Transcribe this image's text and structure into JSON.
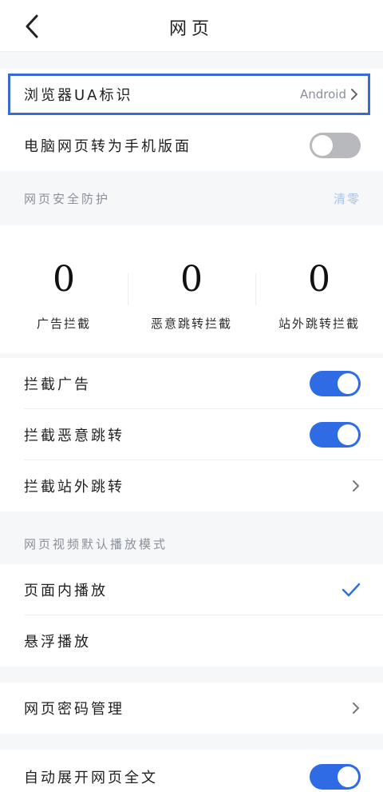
{
  "header": {
    "title": "网页",
    "back_icon": "chevron-left-icon"
  },
  "ua": {
    "label": "浏览器UA标识",
    "value": "Android"
  },
  "pc_to_mobile": {
    "label": "电脑网页转为手机版面",
    "enabled": false
  },
  "security": {
    "title": "网页安全防护",
    "clear_label": "清零",
    "stats": [
      {
        "value": "0",
        "label": "广告拦截"
      },
      {
        "value": "0",
        "label": "恶意跳转拦截"
      },
      {
        "value": "0",
        "label": "站外跳转拦截"
      }
    ]
  },
  "block_ads": {
    "label": "拦截广告",
    "enabled": true
  },
  "block_malicious": {
    "label": "拦截恶意跳转",
    "enabled": true
  },
  "block_external": {
    "label": "拦截站外跳转"
  },
  "video": {
    "title": "网页视频默认播放模式",
    "options": [
      {
        "label": "页面内播放",
        "selected": true
      },
      {
        "label": "悬浮播放",
        "selected": false
      }
    ]
  },
  "password": {
    "label": "网页密码管理"
  },
  "auto_expand": {
    "label": "自动展开网页全文",
    "enabled": true
  },
  "colors": {
    "accent": "#2f6be4",
    "highlight_border": "#3a6ad6",
    "clear_text": "#a8c3e8"
  }
}
